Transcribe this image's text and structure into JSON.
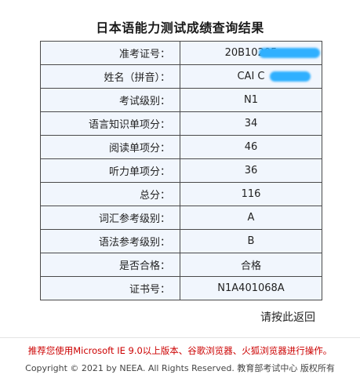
{
  "page": {
    "title": "日本语能力测试成绩查询结果"
  },
  "result": {
    "rows": [
      {
        "label": "准考证号：",
        "value": "20B10205",
        "redacted": true
      },
      {
        "label": "姓名（拼音）：",
        "value": "CAI C",
        "redacted": true
      },
      {
        "label": "考试级别：",
        "value": "N1"
      },
      {
        "label": "语言知识单项分：",
        "value": "34"
      },
      {
        "label": "阅读单项分：",
        "value": "46"
      },
      {
        "label": "听力单项分：",
        "value": "36"
      },
      {
        "label": "总分：",
        "value": "116"
      },
      {
        "label": "词汇参考级别：",
        "value": "A"
      },
      {
        "label": "语法参考级别：",
        "value": "B"
      },
      {
        "label": "是否合格：",
        "value": "合格"
      },
      {
        "label": "证书号：",
        "value": "N1A401068A"
      }
    ]
  },
  "actions": {
    "back_label": "请按此返回"
  },
  "footer": {
    "notice": "推荐您使用Microsoft IE 9.0以上版本、谷歌浏览器、火狐浏览器进行操作。",
    "copyright": "Copyright © 2021 by NEEA. All Rights Reserved. 教育部考试中心 版权所有"
  },
  "colors": {
    "cell_background": "#f1f6fd",
    "border": "#4a4a4a",
    "notice": "#cc0000",
    "redaction": "#2fb0ff"
  }
}
